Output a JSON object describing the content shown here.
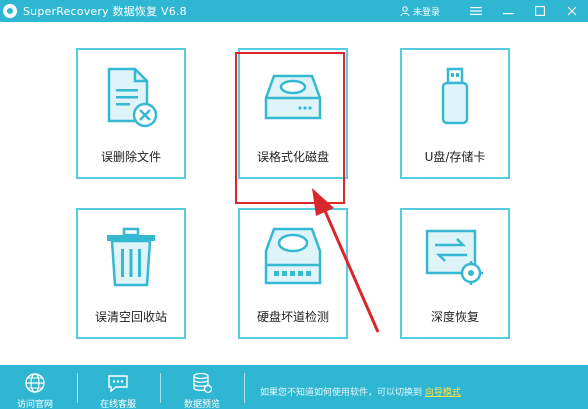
{
  "window": {
    "title": "SuperRecovery 数据恢复 V6.8",
    "login_label": "未登录"
  },
  "cards": [
    {
      "label": "误删除文件",
      "icon": "deleted-file-icon"
    },
    {
      "label": "误格式化磁盘",
      "icon": "formatted-disk-icon"
    },
    {
      "label": "U盘/存储卡",
      "icon": "usb-drive-icon"
    },
    {
      "label": "误清空回收站",
      "icon": "recycle-bin-icon"
    },
    {
      "label": "硬盘坏道检测",
      "icon": "disk-check-icon"
    },
    {
      "label": "深度恢复",
      "icon": "deep-recovery-icon"
    }
  ],
  "footer": {
    "items": [
      {
        "label": "访问官网",
        "icon": "globe-icon"
      },
      {
        "label": "在线客服",
        "icon": "chat-icon"
      },
      {
        "label": "数据预览",
        "icon": "database-icon"
      }
    ],
    "tip_text": "如果您不知道如何使用软件，可以切换到",
    "tip_link": "向导模式"
  },
  "colors": {
    "accent": "#2fb6d3",
    "card_border": "#56cce0",
    "highlight": "#d8272d"
  }
}
